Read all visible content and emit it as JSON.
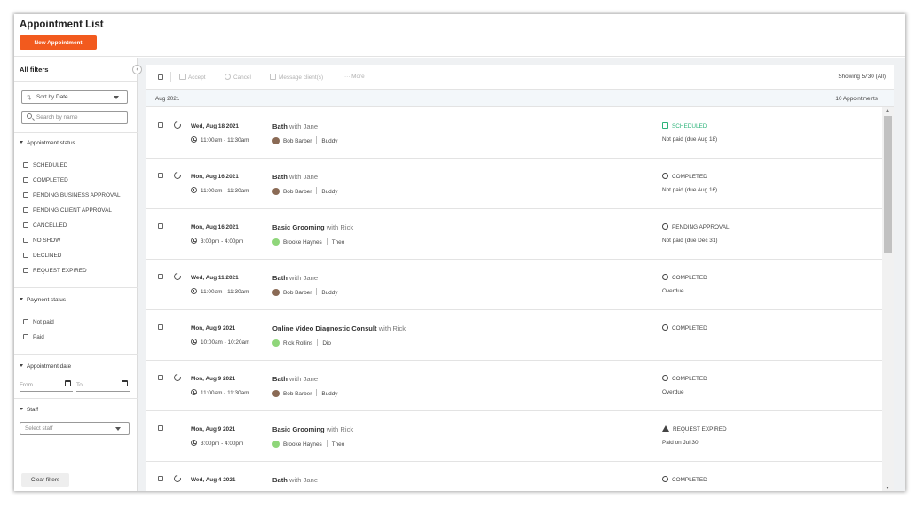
{
  "header": {
    "title": "Appointment List",
    "new_button": "New Appointment"
  },
  "sidebar": {
    "title": "All filters",
    "sort_label": "Sort by",
    "sort_value": "Date",
    "search_placeholder": "Search by name",
    "appointment_status": {
      "title": "Appointment status",
      "options": [
        "SCHEDULED",
        "COMPLETED",
        "PENDING BUSINESS APPROVAL",
        "PENDING CLIENT APPROVAL",
        "CANCELLED",
        "NO SHOW",
        "DECLINED",
        "REQUEST EXPIRED"
      ]
    },
    "payment_status": {
      "title": "Payment status",
      "options": [
        "Not paid",
        "Paid"
      ]
    },
    "appointment_date": {
      "title": "Appointment date",
      "from_placeholder": "From",
      "to_placeholder": "To"
    },
    "staff": {
      "title": "Staff",
      "placeholder": "Select staff"
    },
    "clear_button": "Clear filters"
  },
  "toolbar": {
    "accept": "Accept",
    "cancel": "Cancel",
    "message": "Message client(s)",
    "more": "More",
    "showing": "Showing 5730 (All)"
  },
  "month_group": {
    "month": "Aug 2021",
    "count": "10 Appointments"
  },
  "appointments": [
    {
      "date": "Wed, Aug 18 2021",
      "time": "11:00am - 11:30am",
      "service": "Bath",
      "with": "with Jane",
      "client": "Bob Barber",
      "pet": "Buddy",
      "status": "SCHEDULED",
      "payment": "Not paid (due Aug 18)"
    },
    {
      "date": "Mon, Aug 16 2021",
      "time": "11:00am - 11:30am",
      "service": "Bath",
      "with": "with Jane",
      "client": "Bob Barber",
      "pet": "Buddy",
      "status": "COMPLETED",
      "payment": "Not paid (due Aug 16)"
    },
    {
      "date": "Mon, Aug 16 2021",
      "time": "3:00pm - 4:00pm",
      "service": "Basic Grooming",
      "with": "with Rick",
      "client": "Brooke Haynes",
      "pet": "Theo",
      "status": "PENDING APPROVAL",
      "payment": "Not paid (due Dec 31)"
    },
    {
      "date": "Wed, Aug 11 2021",
      "time": "11:00am - 11:30am",
      "service": "Bath",
      "with": "with Jane",
      "client": "Bob Barber",
      "pet": "Buddy",
      "status": "COMPLETED",
      "payment": "Overdue"
    },
    {
      "date": "Mon, Aug 9 2021",
      "time": "10:00am - 10:20am",
      "service": "Online Video Diagnostic Consult",
      "with": "with Rick",
      "client": "Rick Rollins",
      "pet": "Dio",
      "status": "COMPLETED",
      "payment": ""
    },
    {
      "date": "Mon, Aug 9 2021",
      "time": "11:00am - 11:30am",
      "service": "Bath",
      "with": "with Jane",
      "client": "Bob Barber",
      "pet": "Buddy",
      "status": "COMPLETED",
      "payment": "Overdue"
    },
    {
      "date": "Mon, Aug 9 2021",
      "time": "3:00pm - 4:00pm",
      "service": "Basic Grooming",
      "with": "with Rick",
      "client": "Brooke Haynes",
      "pet": "Theo",
      "status": "REQUEST EXPIRED",
      "payment": "Paid on Jul 30"
    },
    {
      "date": "Wed, Aug 4 2021",
      "time": "",
      "service": "Bath",
      "with": "with Jane",
      "client": "",
      "pet": "",
      "status": "COMPLETED",
      "payment": ""
    }
  ],
  "colors": {
    "accent": "#f25a1e",
    "scheduled": "#2db37a",
    "avatar_bob": "#8a6a55",
    "avatar_green": "#8fd67a"
  }
}
